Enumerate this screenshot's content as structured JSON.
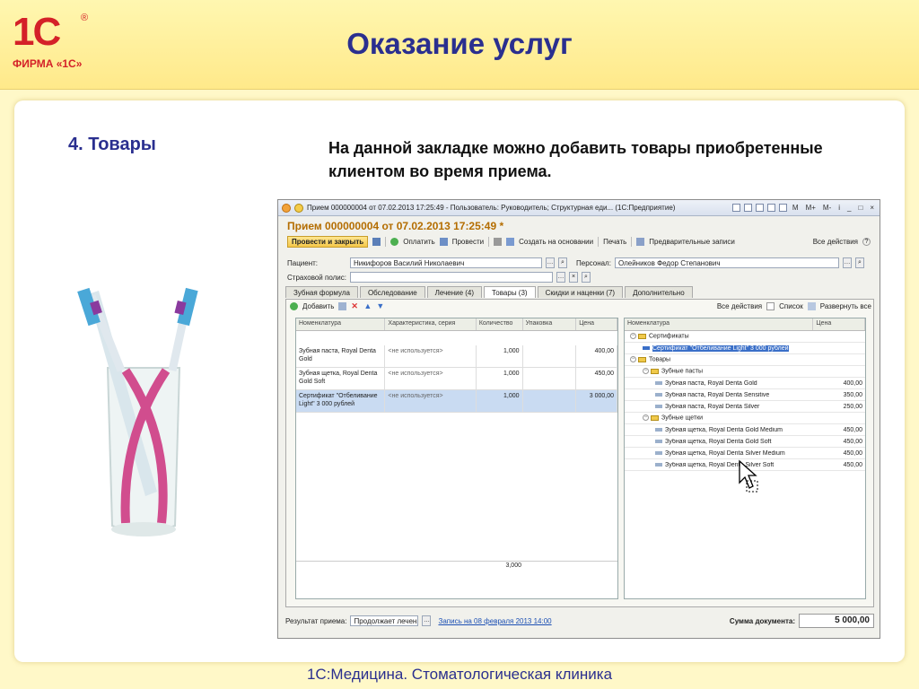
{
  "logo": {
    "mark": "1С",
    "reg": "®",
    "text": "ФИРМА «1С»"
  },
  "title": "Оказание услуг",
  "section_title": "4. Товары",
  "description": "На данной закладке можно добавить товары приобретенные клиентом во время приема.",
  "footer": "1С:Медицина. Стоматологическая клиника",
  "window": {
    "title": "Прием 000000004 от 07.02.2013 17:25:49 - Пользователь: Руководитель; Структурная еди... (1С:Предприятие)",
    "title_buttons": [
      "M",
      "M+",
      "M-",
      "i",
      "_",
      "□",
      "×"
    ],
    "doc_header": "Прием 000000004 от 07.02.2013 17:25:49 *",
    "toolbar": {
      "post_close": "Провести и закрыть",
      "pay": "Оплатить",
      "post": "Провести",
      "create_basis": "Создать на основании",
      "print": "Печать",
      "prelim": "Предварительные записи",
      "all_actions": "Все действия",
      "help": "?"
    },
    "patient_label": "Пациент:",
    "patient_value": "Никифоров Василий Николаевич",
    "personal_label": "Персонал:",
    "personal_value": "Олейников Федор Степанович",
    "insurance_label": "Страховой полис:",
    "insurance_value": "",
    "tabs": [
      "Зубная формула",
      "Обследование",
      "Лечение (4)",
      "Товары (3)",
      "Скидки и наценки (7)",
      "Дополнительно"
    ],
    "subbar": {
      "add": "Добавить",
      "all_actions": "Все действия",
      "list": "Список",
      "expand": "Развернуть все"
    },
    "left_grid": {
      "headers": [
        "Номенклатура",
        "Характеристика, серия",
        "Количество",
        "Упаковка",
        "Цена"
      ],
      "rows": [
        {
          "name": "Зубная паста, Royal Denta Gold",
          "char": "<не используется>",
          "qty": "1,000",
          "pack": "",
          "price": "400,00"
        },
        {
          "name": "Зубная щетка, Royal Denta Gold Soft",
          "char": "<не используется>",
          "qty": "1,000",
          "pack": "",
          "price": "450,00"
        },
        {
          "name": "Сертификат \"Отбеливание Light\" 3 000 рублей",
          "char": "<не используется>",
          "qty": "1,000",
          "pack": "",
          "price": "3 000,00"
        }
      ],
      "total_qty": "3,000"
    },
    "right_tree": {
      "headers": [
        "Номенклатура",
        "Цена"
      ],
      "rows": [
        {
          "level": 0,
          "type": "group",
          "name": "Сертификаты",
          "price": ""
        },
        {
          "level": 1,
          "type": "item",
          "name": "Сертификат \"Отбеливание Light\" 3 000 рублей",
          "price": "",
          "highlight": true
        },
        {
          "level": 0,
          "type": "group",
          "name": "Товары",
          "price": ""
        },
        {
          "level": 1,
          "type": "group",
          "name": "Зубные пасты",
          "price": ""
        },
        {
          "level": 2,
          "type": "item",
          "name": "Зубная паста, Royal Denta Gold",
          "price": "400,00"
        },
        {
          "level": 2,
          "type": "item",
          "name": "Зубная паста, Royal Denta Sensitive",
          "price": "350,00"
        },
        {
          "level": 2,
          "type": "item",
          "name": "Зубная паста, Royal Denta Silver",
          "price": "250,00"
        },
        {
          "level": 1,
          "type": "group",
          "name": "Зубные щетки",
          "price": ""
        },
        {
          "level": 2,
          "type": "item",
          "name": "Зубная щетка, Royal Denta Gold Medium",
          "price": "450,00"
        },
        {
          "level": 2,
          "type": "item",
          "name": "Зубная щетка, Royal Denta Gold Soft",
          "price": "450,00"
        },
        {
          "level": 2,
          "type": "item",
          "name": "Зубная щетка, Royal Denta Silver Medium",
          "price": "450,00"
        },
        {
          "level": 2,
          "type": "item",
          "name": "Зубная щетка, Royal Denta Silver Soft",
          "price": "450,00"
        }
      ]
    },
    "result_label": "Результат приема:",
    "result_value": "Продолжает лечение",
    "appointment_link": "Запись на 08 февраля 2013 14:00",
    "sum_label": "Сумма документа:",
    "sum_value": "5 000,00"
  },
  "colors": {
    "title": "#2a2f8f",
    "brand_red": "#d42128",
    "doc_header": "#b46d00"
  }
}
